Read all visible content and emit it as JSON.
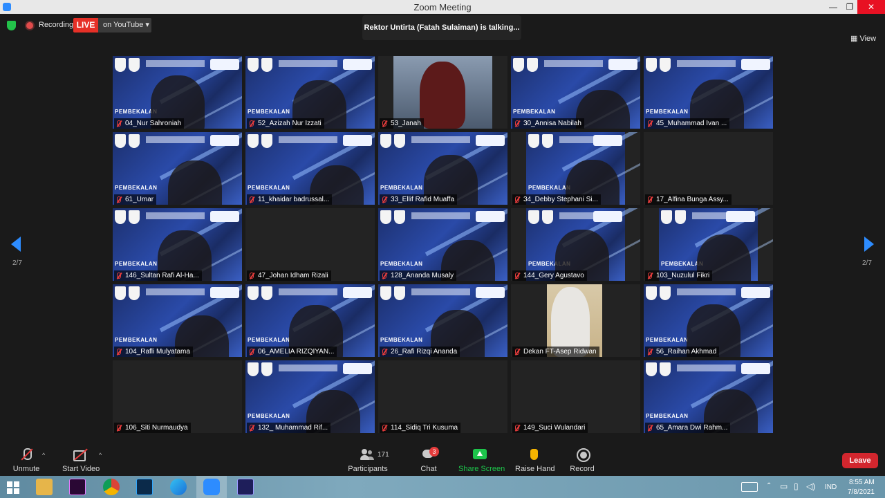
{
  "window": {
    "title": "Zoom Meeting",
    "minimize": "—",
    "restore": "❐",
    "close": "✕"
  },
  "topbar": {
    "recording_label": "Recording",
    "live_label": "LIVE",
    "live_destination": "on YouTube ▾",
    "talking_banner": "Rektor Untirta (Fatah Sulaiman) is talking...",
    "view_label": "View"
  },
  "pager": {
    "left": "2/7",
    "right": "2/7"
  },
  "slide_text": "PEMBEKALAN",
  "participants": [
    {
      "name": "04_Nur Sahroniah",
      "muted": true,
      "video": "slide"
    },
    {
      "name": "52_Azizah Nur Izzati",
      "muted": true,
      "video": "slide"
    },
    {
      "name": "53_Janah",
      "muted": true,
      "video": "camera"
    },
    {
      "name": "30_Annisa Nabilah",
      "muted": true,
      "video": "slide"
    },
    {
      "name": "45_Muhammad Ivan ...",
      "muted": true,
      "video": "slide"
    },
    {
      "name": "61_Umar",
      "muted": true,
      "video": "slide"
    },
    {
      "name": "11_khaidar badrussal...",
      "muted": true,
      "video": "slide"
    },
    {
      "name": "33_Ellif Rafid Muaffa",
      "muted": true,
      "video": "slide"
    },
    {
      "name": "34_Debby Stephani Si...",
      "muted": true,
      "video": "slide-narrow"
    },
    {
      "name": "17_Alfina Bunga Assy...",
      "muted": true,
      "video": "off"
    },
    {
      "name": "146_Sultan Rafi Al-Ha...",
      "muted": true,
      "video": "slide"
    },
    {
      "name": "47_Johan Idham Rizali",
      "muted": true,
      "video": "off"
    },
    {
      "name": "128_Ananda Musaly",
      "muted": true,
      "video": "slide"
    },
    {
      "name": "144_Gery Agustavo",
      "muted": true,
      "video": "slide-narrow"
    },
    {
      "name": "103_Nuzulul Fikri",
      "muted": true,
      "video": "slide-narrow"
    },
    {
      "name": "104_Rafli Mulyatama",
      "muted": true,
      "video": "slide"
    },
    {
      "name": "06_AMELIA RIZQIYAN...",
      "muted": true,
      "video": "slide"
    },
    {
      "name": "26_Rafi Rizqi Ananda",
      "muted": true,
      "video": "slide"
    },
    {
      "name": "Dekan FT-Asep Ridwan",
      "muted": true,
      "video": "camera2"
    },
    {
      "name": "56_Raihan Akhmad",
      "muted": true,
      "video": "slide"
    },
    {
      "name": "106_Siti Nurmaudya",
      "muted": true,
      "video": "off"
    },
    {
      "name": "132_ Muhammad Rif...",
      "muted": true,
      "video": "slide"
    },
    {
      "name": "114_Sidiq Tri Kusuma",
      "muted": true,
      "video": "off"
    },
    {
      "name": "149_Suci Wulandari",
      "muted": true,
      "video": "off"
    },
    {
      "name": "65_Amara Dwi Rahm...",
      "muted": true,
      "video": "slide"
    }
  ],
  "controls": {
    "unmute": "Unmute",
    "start_video": "Start Video",
    "participants": "Participants",
    "participant_count": "171",
    "chat": "Chat",
    "chat_badge": "3",
    "share_screen": "Share Screen",
    "raise_hand": "Raise Hand",
    "record": "Record",
    "leave": "Leave",
    "caret": "^"
  },
  "colors": {
    "accent": "#2d8cff",
    "share": "#1dc54b",
    "leave": "#d2262e",
    "live": "#e63027"
  },
  "taskbar": {
    "time": "8:55 AM",
    "date": "7/8/2021",
    "lang": "IND"
  }
}
